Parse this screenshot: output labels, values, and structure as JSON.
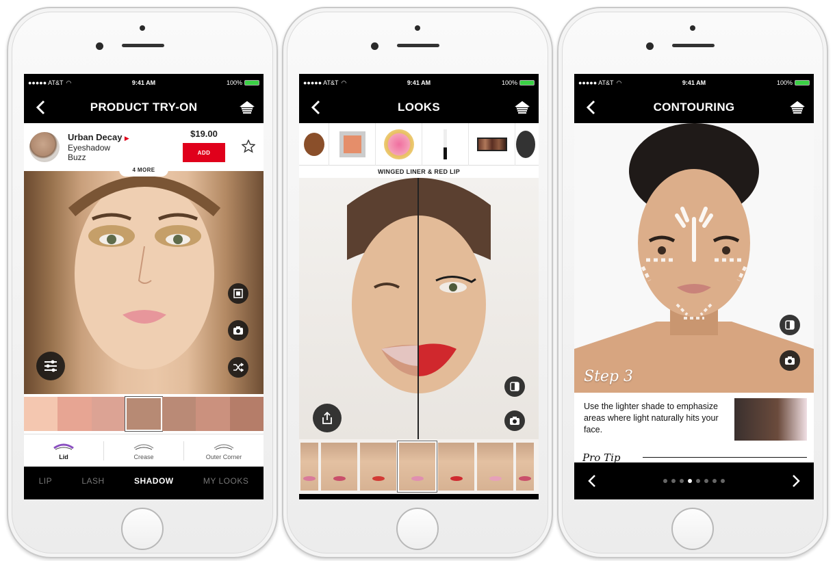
{
  "status": {
    "carrier": "●●●●● AT&T",
    "time": "9:41 AM",
    "battery": "100%"
  },
  "phone1": {
    "nav_title": "PRODUCT TRY-ON",
    "product": {
      "brand": "Urban Decay",
      "type": "Eyeshadow",
      "shade": "Buzz",
      "price": "$19.00",
      "add_label": "ADD",
      "more_label": "4 MORE"
    },
    "swatches": [
      "#f4c7b0",
      "#e7a593",
      "#dca394",
      "#b78a74",
      "#ba8a76",
      "#cb917e",
      "#b57d69"
    ],
    "selected_swatch": 3,
    "areas": [
      {
        "label": "Lid",
        "active": true
      },
      {
        "label": "Crease",
        "active": false
      },
      {
        "label": "Outer Corner",
        "active": false
      }
    ],
    "tabs": [
      {
        "label": "LIP",
        "active": false
      },
      {
        "label": "LASH",
        "active": false
      },
      {
        "label": "SHADOW",
        "active": true
      },
      {
        "label": "MY LOOKS",
        "active": false
      }
    ]
  },
  "phone2": {
    "nav_title": "LOOKS",
    "look_label": "WINGED LINER & RED LIP",
    "thumb_lips": [
      "#d97a9a",
      "#c94f6a",
      "#d23a34",
      "#e08fb0",
      "#cf2a2f",
      "#e6a1b9",
      "#c94f6a"
    ],
    "selected_thumb": 3
  },
  "phone3": {
    "nav_title": "CONTOURING",
    "step_label": "Step 3",
    "tip_text": "Use the lighter shade to emphasize areas where light naturally hits your face.",
    "pro_tip_label": "Pro Tip",
    "page_count": 8,
    "current_page": 3
  },
  "colors": {
    "accent_red": "#e0001b",
    "battery_green": "#3bd145"
  }
}
